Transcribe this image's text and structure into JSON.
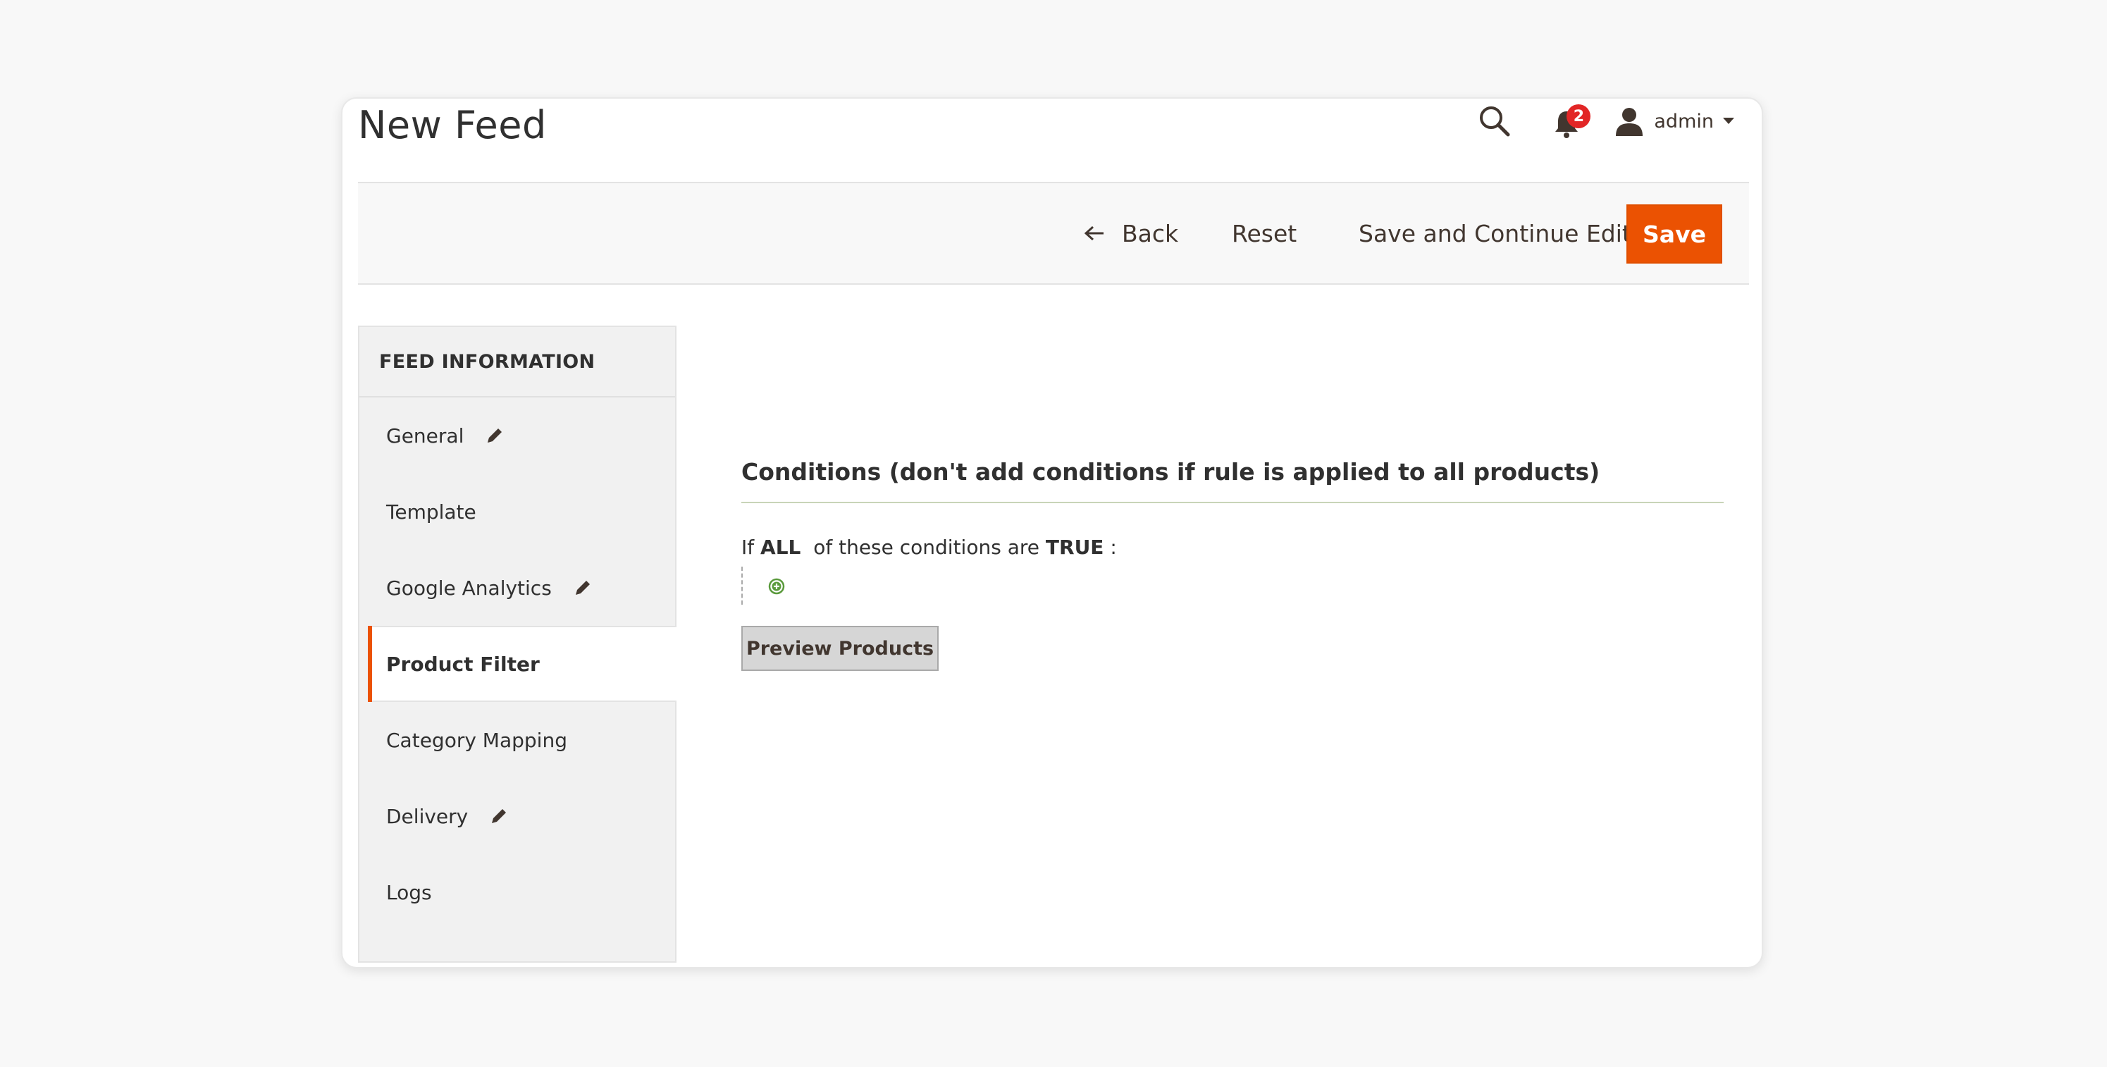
{
  "page": {
    "title": "New Feed"
  },
  "header": {
    "notifications_count": "2",
    "user_name": "admin"
  },
  "toolbar": {
    "back_label": "Back",
    "reset_label": "Reset",
    "save_continue_label": "Save and Continue Edit",
    "save_label": "Save"
  },
  "sidebar": {
    "title": "FEED INFORMATION",
    "items": [
      {
        "label": "General",
        "edited": true
      },
      {
        "label": "Template",
        "edited": false
      },
      {
        "label": "Google Analytics",
        "edited": true
      },
      {
        "label": "Product Filter",
        "edited": false,
        "active": true
      },
      {
        "label": "Category Mapping",
        "edited": false
      },
      {
        "label": "Delivery",
        "edited": true
      },
      {
        "label": "Logs",
        "edited": false
      }
    ]
  },
  "conditions": {
    "heading": "Conditions (don't add conditions if rule is applied to all products)",
    "prefix": "If",
    "aggregator": "ALL",
    "middle": "of these conditions are",
    "value": "TRUE",
    "suffix": ":",
    "preview_button": "Preview Products"
  },
  "colors": {
    "accent": "#eb5202",
    "badge": "#e22626",
    "add_icon": "#5a9a3c"
  }
}
